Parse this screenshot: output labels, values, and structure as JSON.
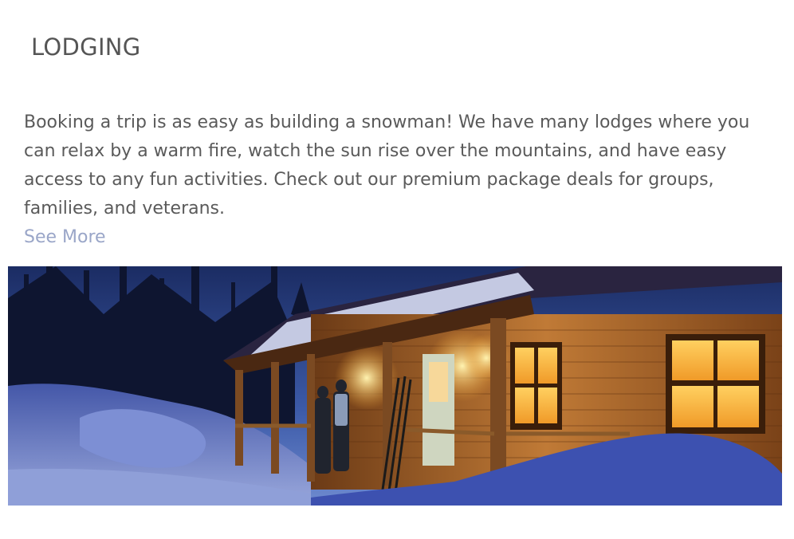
{
  "section": {
    "title": "LODGING",
    "description": "Booking a trip is as easy as building a snowman! We have many lodges where you can relax by a warm fire, watch the sun rise over the mountains, and have easy access to any fun activities. Check out our premium package deals for groups, families, and veterans.",
    "link_label": "See More"
  },
  "colors": {
    "heading": "#555555",
    "body_text": "#5a5a5a",
    "link": "#9aa6c8"
  },
  "photo": {
    "subject": "log cabin lodge at dusk in snow with lit porch"
  }
}
